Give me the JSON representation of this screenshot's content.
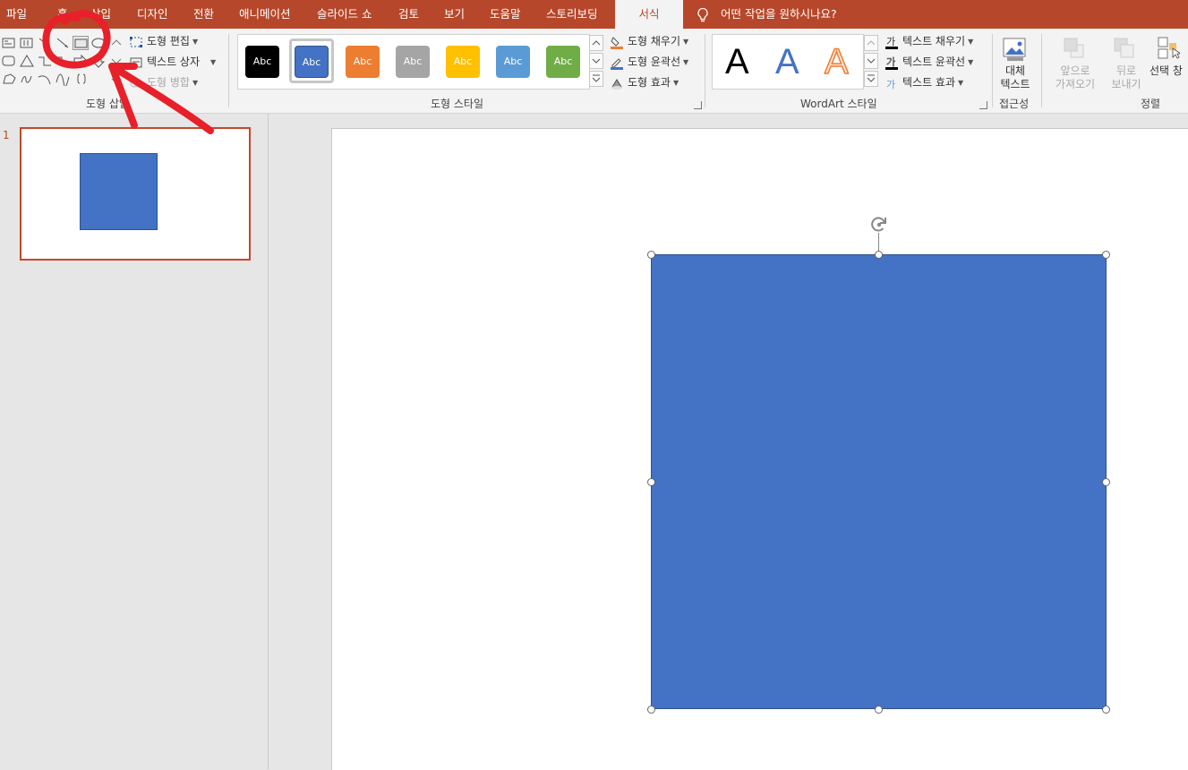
{
  "tabs": {
    "file": "파일",
    "home": "홈",
    "insert": "삽입",
    "design": "디자인",
    "transitions": "전환",
    "animations": "애니메이션",
    "slideshow": "슬라이드 쇼",
    "review": "검토",
    "view": "보기",
    "help": "도움말",
    "storyboarding": "스토리보딩",
    "format": "서식"
  },
  "tell_me": "어떤 작업을 원하시나요?",
  "insert_shapes_group": {
    "edit_shape": "도형 편집",
    "text_box": "텍스트 상자",
    "merge_shapes": "도형 병합",
    "label": "도형 삽입"
  },
  "shape_styles_group": {
    "swatch_text": "Abc",
    "swatches": [
      "#000000",
      "#4472c4",
      "#ed7d31",
      "#a5a5a5",
      "#ffc000",
      "#5b9bd5",
      "#70ad47"
    ],
    "shape_fill": "도형 채우기",
    "shape_outline": "도형 윤곽선",
    "shape_effects": "도형 효과",
    "label": "도형 스타일"
  },
  "wordart_group": {
    "letter": "A",
    "text_fill": "텍스트 채우기",
    "text_outline": "텍스트 윤곽선",
    "text_effects": "텍스트 효과",
    "label": "WordArt 스타일"
  },
  "accessibility_group": {
    "alt_text": "대체\n텍스트",
    "label": "접근성"
  },
  "arrange_group": {
    "bring_forward": "앞으로\n가져오기",
    "send_backward": "뒤로\n보내기",
    "selection_pane": "선택 창",
    "label": "정렬"
  },
  "slides": [
    {
      "number": "1"
    }
  ],
  "colors": {
    "accent": "#b7472a",
    "shape_fill": "#4472c4",
    "shape_outline": "#2f528f",
    "annotation": "#e8202a"
  }
}
